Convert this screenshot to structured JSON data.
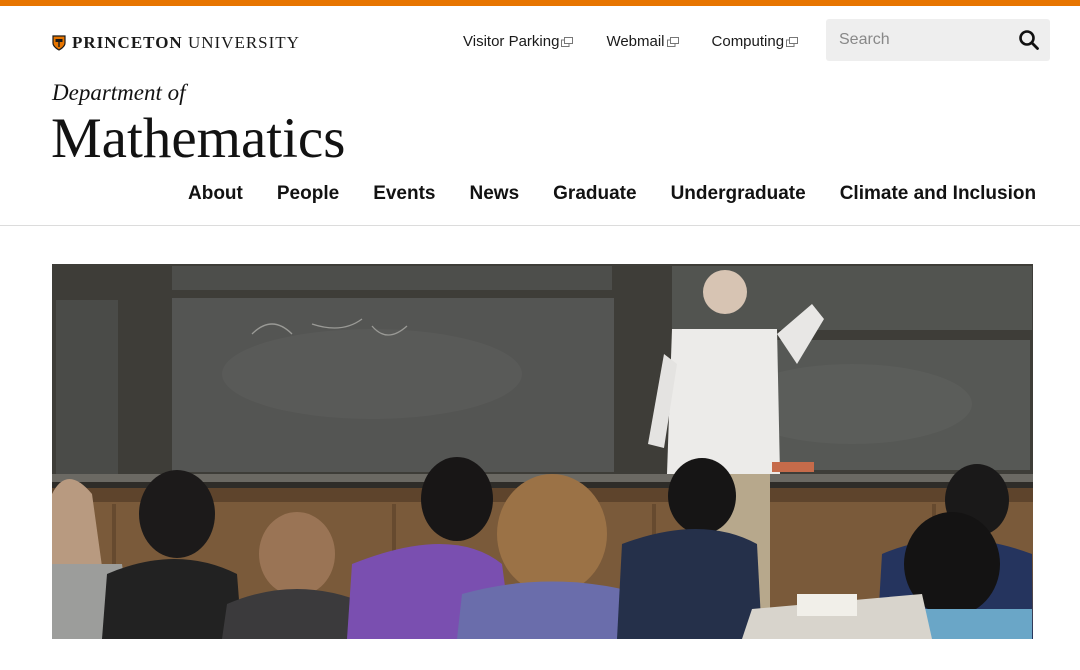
{
  "colors": {
    "accent": "#e77500",
    "search_bg": "#eeeeee"
  },
  "university": {
    "name_bold": "PRINCETON",
    "name_rest": "UNIVERSITY",
    "logo_icon": "shield-icon"
  },
  "utility_links": [
    {
      "label": "Visitor Parking",
      "icon": "external-link-icon"
    },
    {
      "label": "Webmail",
      "icon": "external-link-icon"
    },
    {
      "label": "Computing",
      "icon": "external-link-icon"
    }
  ],
  "search": {
    "placeholder": "Search",
    "value": "",
    "icon": "search-icon"
  },
  "department": {
    "prefix": "Department of",
    "name": "Mathematics"
  },
  "nav": [
    {
      "label": "About"
    },
    {
      "label": "People"
    },
    {
      "label": "Events"
    },
    {
      "label": "News"
    },
    {
      "label": "Graduate"
    },
    {
      "label": "Undergraduate"
    },
    {
      "label": "Climate and Inclusion"
    }
  ]
}
